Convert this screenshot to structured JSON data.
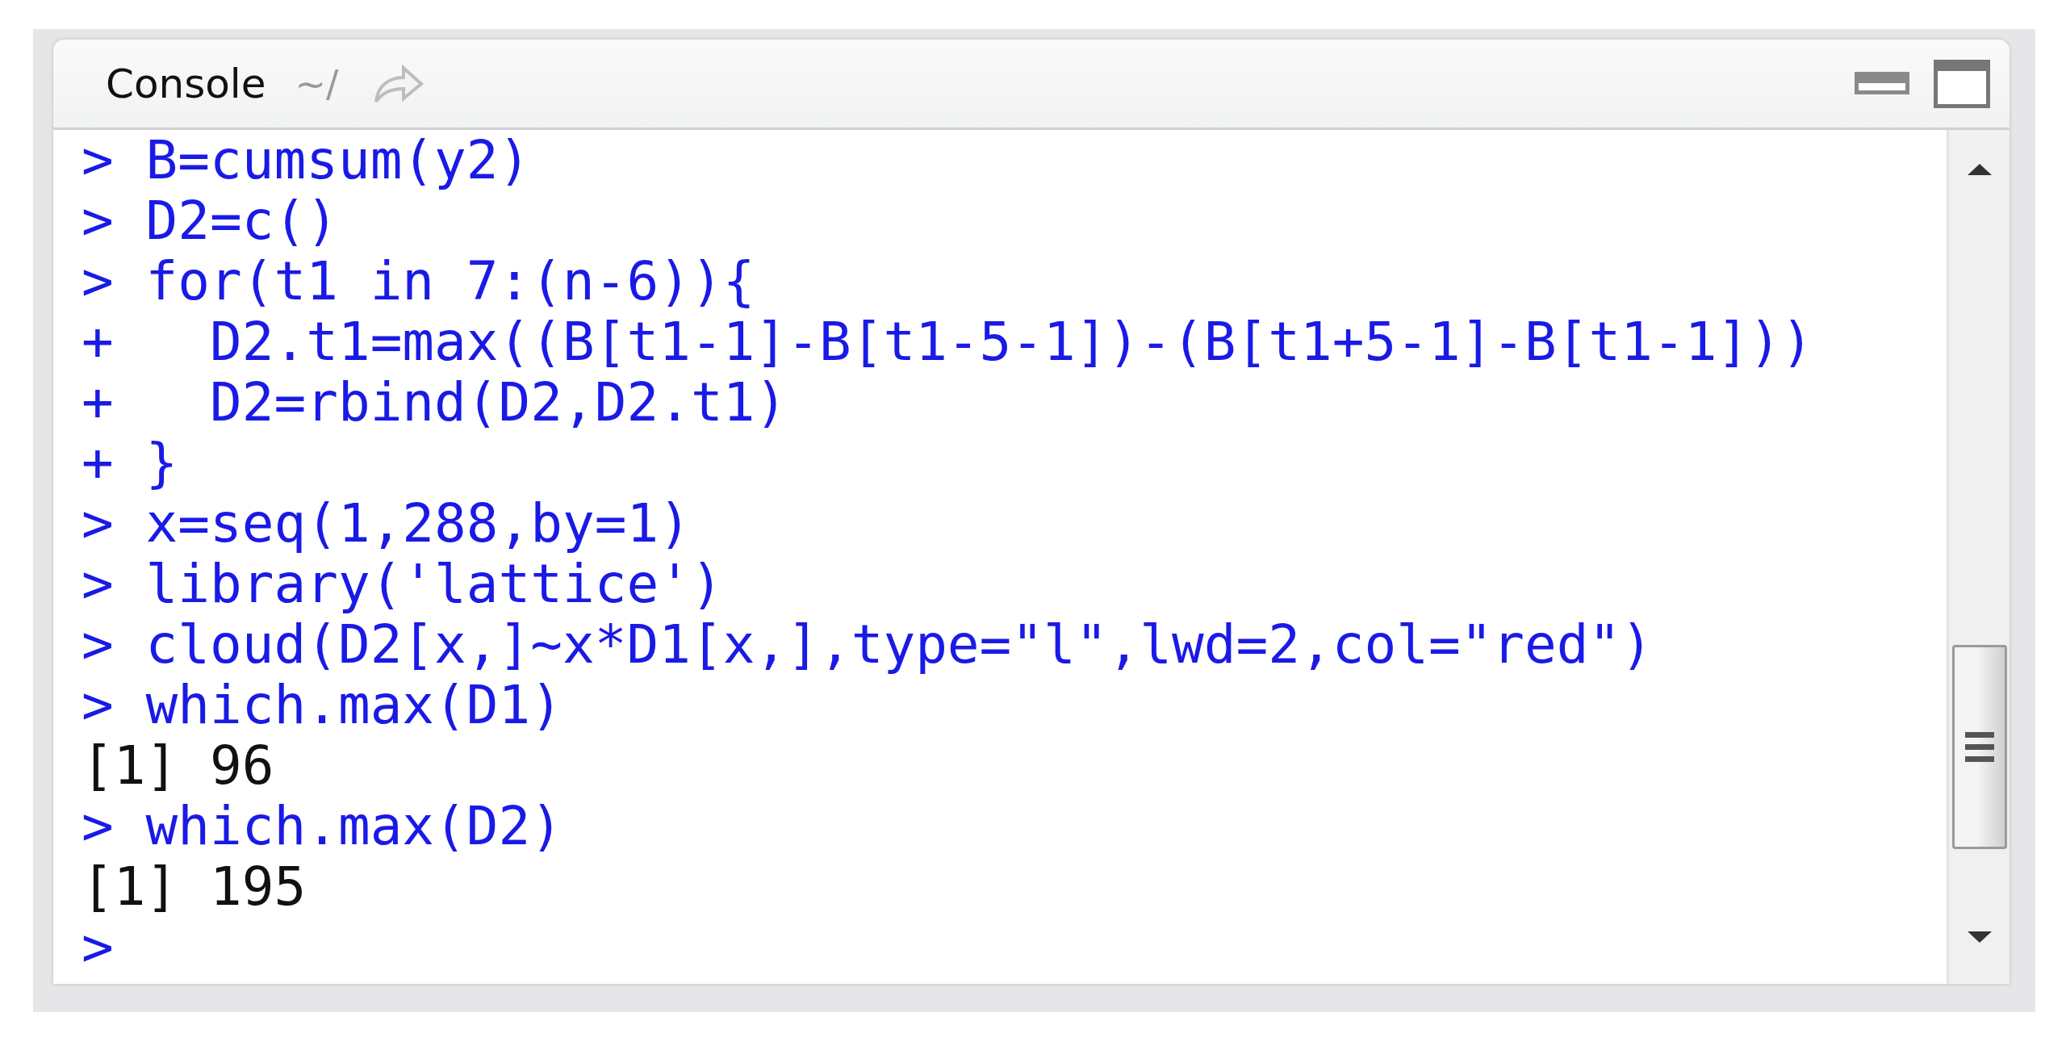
{
  "panel": {
    "title": "Console",
    "path": "~/"
  },
  "lines": [
    {
      "kind": "input",
      "prompt": ">",
      "text": "B=cumsum(y2)"
    },
    {
      "kind": "input",
      "prompt": ">",
      "text": "D2=c()"
    },
    {
      "kind": "input",
      "prompt": ">",
      "text": "for(t1 in 7:(n-6)){"
    },
    {
      "kind": "input",
      "prompt": "+",
      "text": "  D2.t1=max((B[t1-1]-B[t1-5-1])-(B[t1+5-1]-B[t1-1]))"
    },
    {
      "kind": "input",
      "prompt": "+",
      "text": "  D2=rbind(D2,D2.t1)"
    },
    {
      "kind": "input",
      "prompt": "+",
      "text": "}"
    },
    {
      "kind": "input",
      "prompt": ">",
      "text": "x=seq(1,288,by=1)"
    },
    {
      "kind": "input",
      "prompt": ">",
      "text": "library('lattice')"
    },
    {
      "kind": "input",
      "prompt": ">",
      "text": "cloud(D2[x,]~x*D1[x,],type=\"l\",lwd=2,col=\"red\")"
    },
    {
      "kind": "input",
      "prompt": ">",
      "text": "which.max(D1)"
    },
    {
      "kind": "output",
      "text": "[1] 96"
    },
    {
      "kind": "input",
      "prompt": ">",
      "text": "which.max(D2)"
    },
    {
      "kind": "output",
      "text": "[1] 195"
    },
    {
      "kind": "input",
      "prompt": ">"
    }
  ]
}
